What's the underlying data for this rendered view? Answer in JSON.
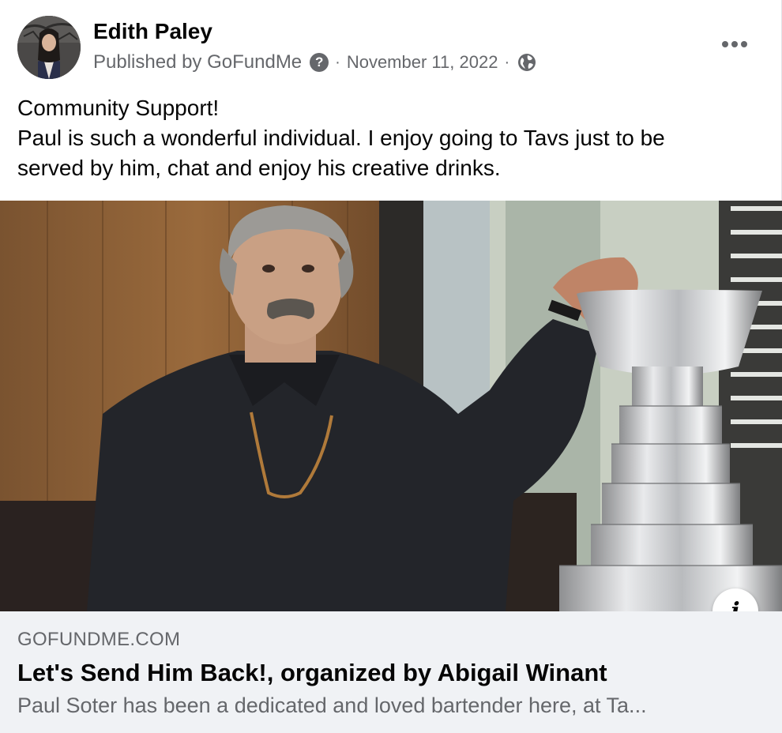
{
  "post": {
    "author_name": "Edith Paley",
    "publisher_text": "Published by GoFundMe",
    "help_icon": "question-mark-icon",
    "separator": "·",
    "date": "November 11, 2022",
    "privacy_icon": "globe-icon",
    "more_icon": "more-options-icon",
    "message_lines": [
      "Community Support!",
      "Paul is such a wonderful individual. I enjoy going to Tavs just to be",
      "served by him, chat and enjoy his creative drinks."
    ]
  },
  "link_preview": {
    "domain": "GOFUNDME.COM",
    "title": "Let's Send Him Back!, organized by Abigail Winant",
    "description": "Paul Soter has been a dedicated and loved bartender here, at Ta...",
    "info_icon": "info-icon",
    "info_glyph": "i"
  },
  "colors": {
    "primary_text": "#050505",
    "secondary_text": "#65676b",
    "card_background": "#f0f2f5"
  }
}
